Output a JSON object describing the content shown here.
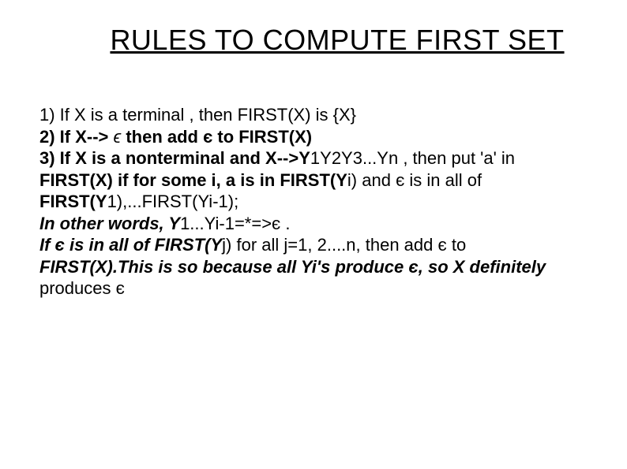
{
  "title": "RULES TO COMPUTE FIRST SET",
  "rule1": " 1) If X is a terminal , then FIRST(X) is {X}",
  "rule2_a": " 2)  If X--> ",
  "rule2_eps": "ϵ",
  "rule2_b": " then add є  to FIRST(X)",
  "rule3_a": " 3)  If X is a nonterminal and X-->Y",
  "rule3_b": "1Y2Y3...Yn , then put 'a' in",
  "rule3_c": " FIRST(X) if for some i, a is in FIRST(Y",
  "rule3_d": "i) and є is in all of",
  "rule3_e": " FIRST(Y",
  "rule3_f": "1),...FIRST(Yi-1);",
  "rule3_g": " In other words,  Y",
  "rule3_h": "1...Yi-1=*=>є .",
  "rule3_i": " If є is in all of FIRST(Y",
  "rule3_j": "j) for all j=1, 2....n, then add є to",
  "rule3_k": " FIRST(X).This is so because all Yi's produce є, so X definitely",
  "rule3_l": "produces є"
}
